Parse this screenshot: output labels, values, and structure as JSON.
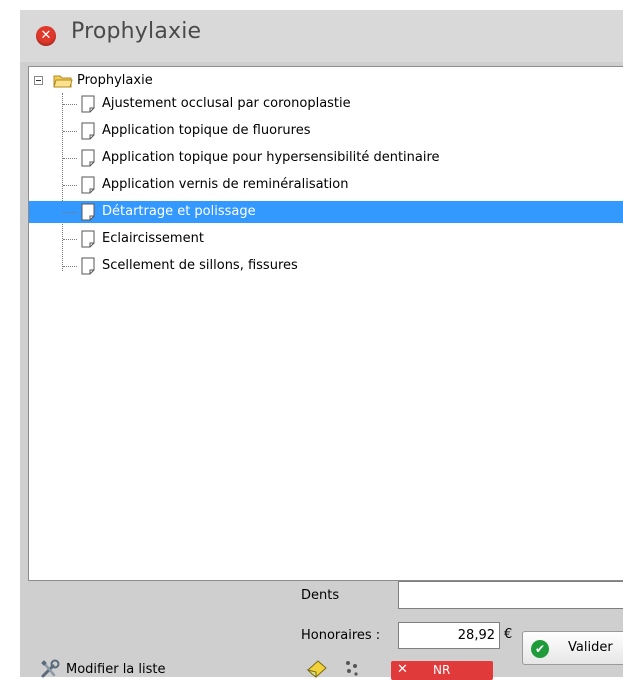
{
  "window": {
    "title": "Prophylaxie",
    "close_icon": "✕"
  },
  "tree": {
    "root_label": "Prophylaxie",
    "items": [
      {
        "label": "Ajustement occlusal par coronoplastie",
        "selected": false
      },
      {
        "label": "Application topique de fluorures",
        "selected": false
      },
      {
        "label": "Application topique pour hypersensibilité dentinaire",
        "selected": false
      },
      {
        "label": "Application vernis de reminéralisation",
        "selected": false
      },
      {
        "label": "Détartrage et polissage",
        "selected": true
      },
      {
        "label": "Eclaircissement",
        "selected": false
      },
      {
        "label": "Scellement de sillons, fissures",
        "selected": false
      }
    ]
  },
  "form": {
    "dents_label": "Dents",
    "dents_value": "",
    "honoraires_label": "Honoraires :",
    "honoraires_value": "28,92",
    "currency": "€"
  },
  "buttons": {
    "valider_label": "Valider",
    "check_glyph": "✔",
    "nr_label": "NR",
    "nr_glyph": "✕",
    "modifier_label": "Modifier la liste"
  },
  "colors": {
    "selection": "#3399ff",
    "valider_check": "#1f9b3a",
    "nr_button": "#e03a3a",
    "close_button": "#e0392b"
  }
}
